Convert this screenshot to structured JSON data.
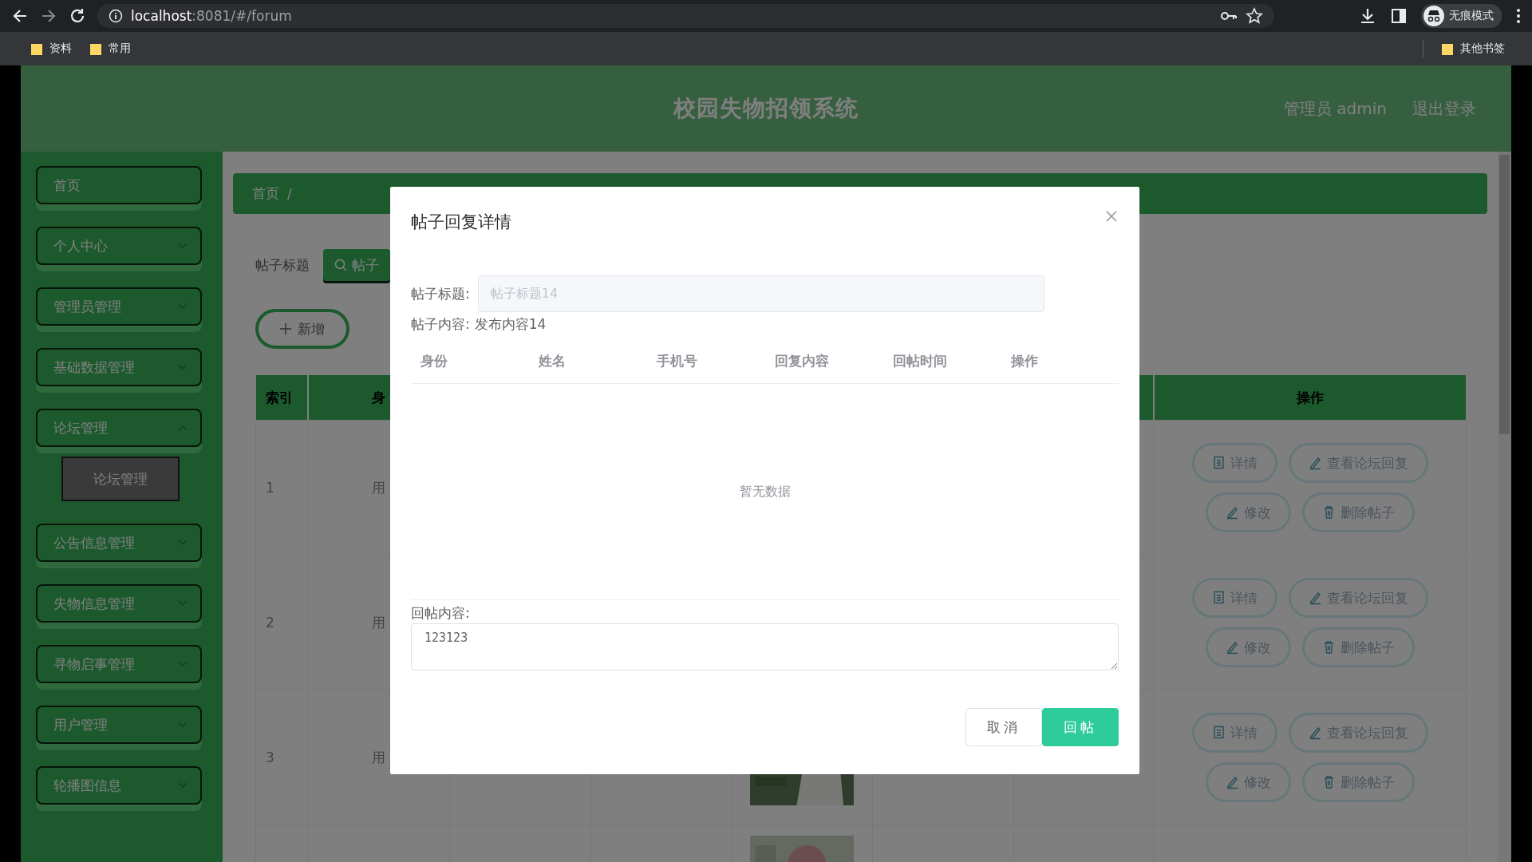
{
  "browser": {
    "url_host": "localhost",
    "url_rest": ":8081/#/forum",
    "profile_label": "无痕模式",
    "bookmarks": [
      {
        "label": "资料"
      },
      {
        "label": "常用"
      }
    ],
    "other_bookmarks": "其他书签"
  },
  "header": {
    "title": "校园失物招领系统",
    "user": "管理员 admin",
    "logout": "退出登录"
  },
  "sidebar": {
    "items": [
      {
        "label": "首页",
        "kind": "link"
      },
      {
        "label": "个人中心",
        "kind": "menu"
      },
      {
        "label": "管理员管理",
        "kind": "menu"
      },
      {
        "label": "基础数据管理",
        "kind": "menu"
      },
      {
        "label": "论坛管理",
        "kind": "menu",
        "expanded": true,
        "children": [
          {
            "label": "论坛管理",
            "selected": true
          }
        ]
      },
      {
        "label": "公告信息管理",
        "kind": "menu"
      },
      {
        "label": "失物信息管理",
        "kind": "menu"
      },
      {
        "label": "寻物启事管理",
        "kind": "menu"
      },
      {
        "label": "用户管理",
        "kind": "menu"
      },
      {
        "label": "轮播图信息",
        "kind": "menu"
      }
    ]
  },
  "breadcrumb": {
    "home": "首页",
    "separator": "/"
  },
  "search": {
    "label": "帖子标题",
    "button": "帖子"
  },
  "add_button": "新增",
  "table": {
    "columns": [
      "索引",
      "身",
      "操作"
    ],
    "rows": [
      {
        "index": "1",
        "identity": "用",
        "actions": [
          {
            "label": "详情",
            "kind": "detail"
          },
          {
            "label": "查看论坛回复",
            "kind": "edit"
          },
          {
            "label": "修改",
            "kind": "edit"
          },
          {
            "label": "删除帖子",
            "kind": "delete"
          }
        ]
      },
      {
        "index": "2",
        "identity": "用",
        "actions": [
          {
            "label": "详情",
            "kind": "detail"
          },
          {
            "label": "查看论坛回复",
            "kind": "edit"
          },
          {
            "label": "修改",
            "kind": "edit"
          },
          {
            "label": "删除帖子",
            "kind": "delete"
          }
        ]
      },
      {
        "index": "3",
        "identity": "用",
        "has_picture": true,
        "actions": [
          {
            "label": "详情",
            "kind": "detail"
          },
          {
            "label": "查看论坛回复",
            "kind": "edit"
          },
          {
            "label": "修改",
            "kind": "edit"
          },
          {
            "label": "删除帖子",
            "kind": "delete"
          }
        ]
      },
      {
        "has_picture": true
      }
    ]
  },
  "modal": {
    "title": "帖子回复详情",
    "fields": [
      {
        "label": "帖子标题:",
        "value": "帖子标题14",
        "disabled": true
      }
    ],
    "content_label": "帖子内容:",
    "content_value": "发布内容14",
    "reply_columns": [
      "身份",
      "姓名",
      "手机号",
      "回复内容",
      "回帖时间",
      "操作"
    ],
    "empty_text": "暂无数据",
    "reply_label": "回帖内容:",
    "reply_value": "123123",
    "buttons": [
      {
        "label": "取消",
        "kind": "default"
      },
      {
        "label": "回帖",
        "kind": "primary"
      }
    ]
  }
}
